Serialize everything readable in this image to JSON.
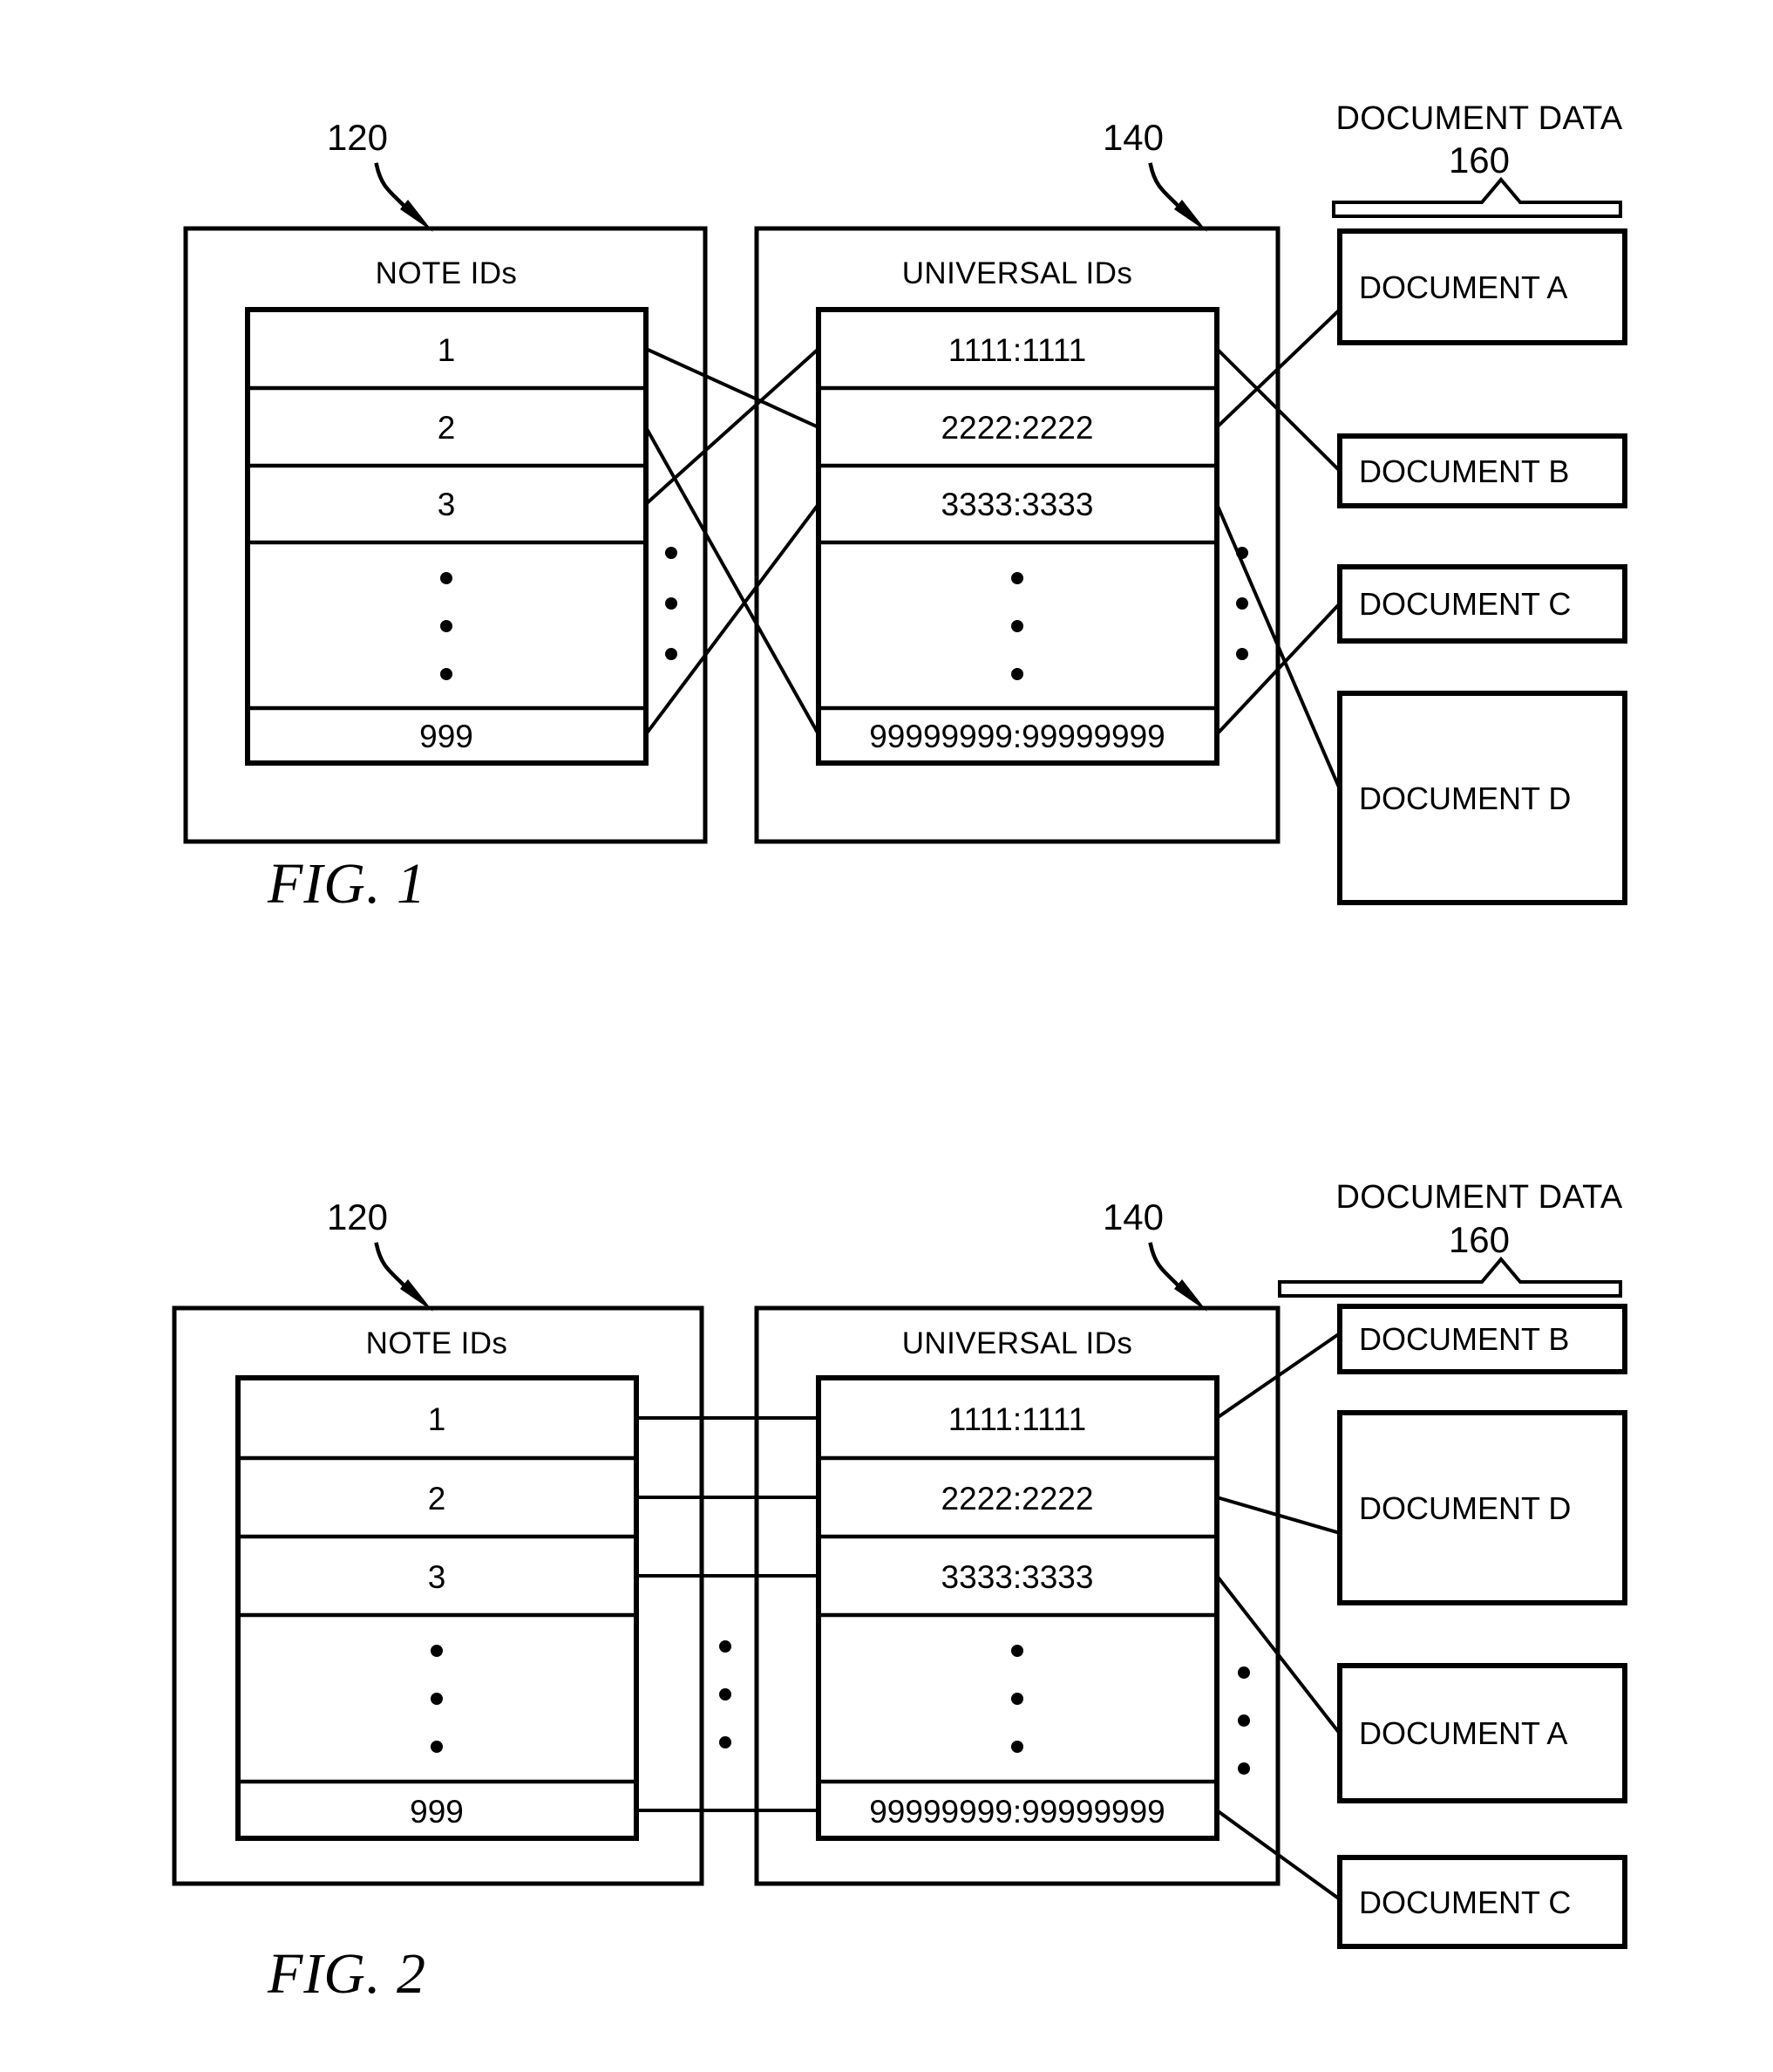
{
  "document": {
    "type": "patent-drawing-sheet",
    "figures": [
      {
        "id": "fig1",
        "caption": "FIG. 1",
        "note_table": {
          "ref": "120",
          "header": "NOTE IDs",
          "rows": [
            "1",
            "2",
            "3",
            "⋮",
            "999"
          ]
        },
        "universal_table": {
          "ref": "140",
          "header": "UNIVERSAL IDs",
          "rows": [
            "1111:1111",
            "2222:2222",
            "3333:3333",
            "⋮",
            "99999999:99999999"
          ]
        },
        "document_data": {
          "ref": "160",
          "label": "DOCUMENT DATA",
          "documents": [
            "DOCUMENT A",
            "DOCUMENT B",
            "DOCUMENT C",
            "DOCUMENT D"
          ]
        },
        "note_to_universal_links": [
          {
            "from": "1",
            "to": "2222:2222"
          },
          {
            "from": "2",
            "to": "99999999:99999999"
          },
          {
            "from": "3",
            "to": "1111:1111"
          },
          {
            "from": "999",
            "to": "3333:3333"
          }
        ],
        "universal_to_document_links": [
          {
            "from": "1111:1111",
            "to": "DOCUMENT B"
          },
          {
            "from": "2222:2222",
            "to": "DOCUMENT A"
          },
          {
            "from": "3333:3333",
            "to": "DOCUMENT D"
          },
          {
            "from": "99999999:99999999",
            "to": "DOCUMENT C"
          }
        ]
      },
      {
        "id": "fig2",
        "caption": "FIG. 2",
        "note_table": {
          "ref": "120",
          "header": "NOTE IDs",
          "rows": [
            "1",
            "2",
            "3",
            "⋮",
            "999"
          ]
        },
        "universal_table": {
          "ref": "140",
          "header": "UNIVERSAL IDs",
          "rows": [
            "1111:1111",
            "2222:2222",
            "3333:3333",
            "⋮",
            "99999999:99999999"
          ]
        },
        "document_data": {
          "ref": "160",
          "label": "DOCUMENT DATA",
          "documents": [
            "DOCUMENT B",
            "DOCUMENT D",
            "DOCUMENT A",
            "DOCUMENT C"
          ]
        },
        "note_to_universal_links": [
          {
            "from": "1",
            "to": "1111:1111"
          },
          {
            "from": "2",
            "to": "2222:2222"
          },
          {
            "from": "3",
            "to": "3333:3333"
          },
          {
            "from": "999",
            "to": "99999999:99999999"
          }
        ],
        "universal_to_document_links": [
          {
            "from": "1111:1111",
            "to": "DOCUMENT B"
          },
          {
            "from": "2222:2222",
            "to": "DOCUMENT D"
          },
          {
            "from": "3333:3333",
            "to": "DOCUMENT A"
          },
          {
            "from": "99999999:99999999",
            "to": "DOCUMENT C"
          }
        ]
      }
    ],
    "colors": {
      "ink": "#000000",
      "paper": "#ffffff"
    }
  }
}
